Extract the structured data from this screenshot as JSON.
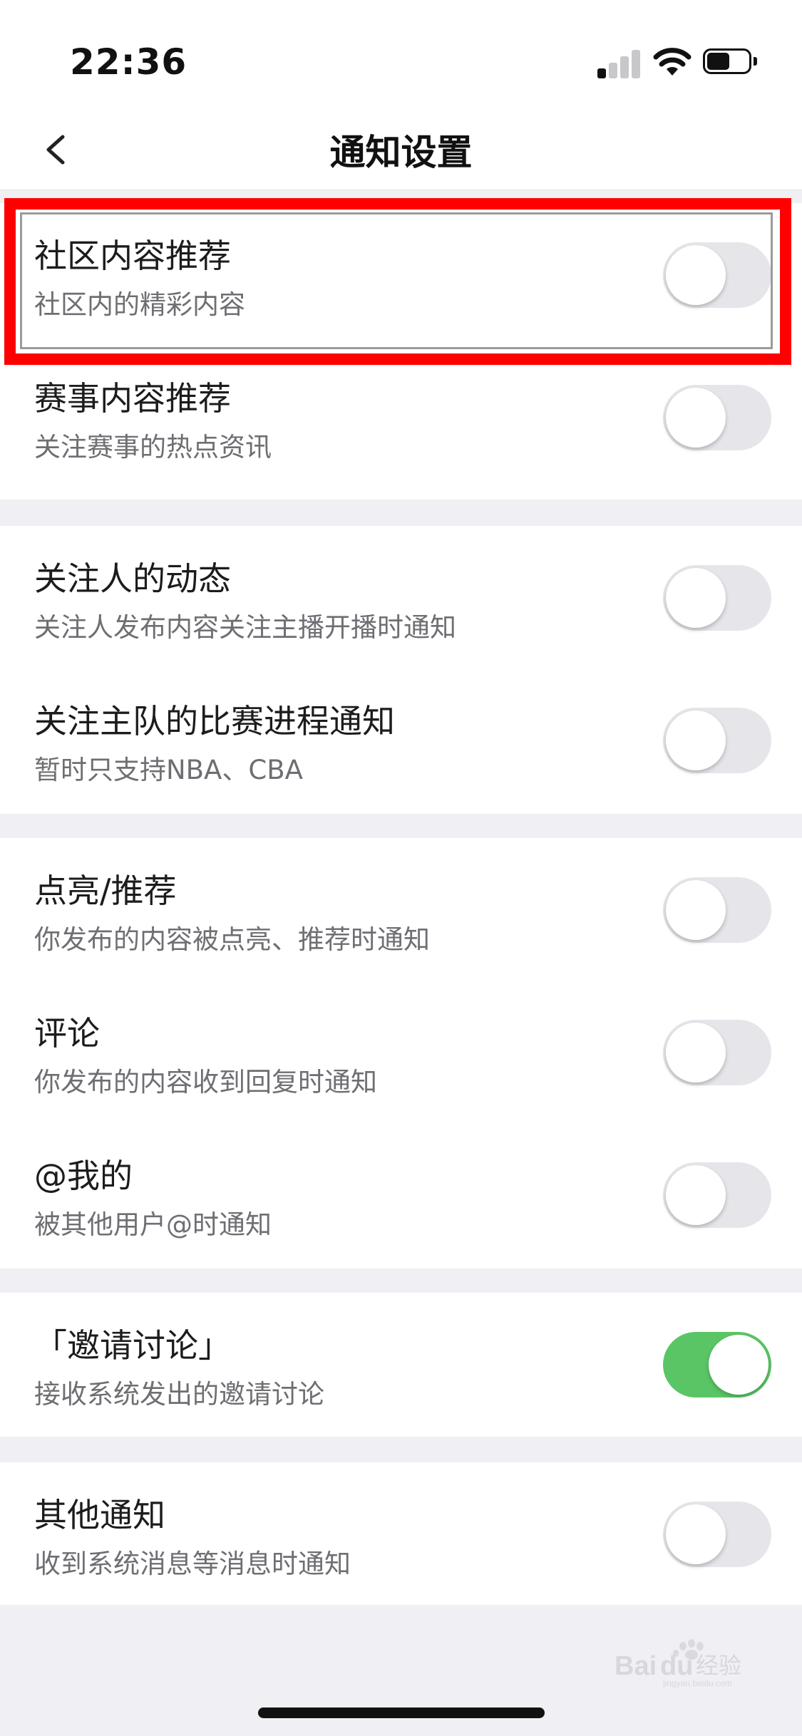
{
  "status_bar": {
    "time": "22:36",
    "battery_level": 0.55
  },
  "nav": {
    "title": "通知设置",
    "back_icon": "chevron-left-icon"
  },
  "settings": [
    {
      "title": "社区内容推荐",
      "subtitle": "社区内的精彩内容",
      "enabled": false
    },
    {
      "title": "赛事内容推荐",
      "subtitle": "关注赛事的热点资讯",
      "enabled": false
    },
    {
      "title": "关注人的动态",
      "subtitle": "关注人发布内容关注主播开播时通知",
      "enabled": false
    },
    {
      "title": "关注主队的比赛进程通知",
      "subtitle": "暂时只支持NBA、CBA",
      "enabled": false
    },
    {
      "title": "点亮/推荐",
      "subtitle": "你发布的内容被点亮、推荐时通知",
      "enabled": false
    },
    {
      "title": "评论",
      "subtitle": "你发布的内容收到回复时通知",
      "enabled": false
    },
    {
      "title": "@我的",
      "subtitle": "被其他用户@时通知",
      "enabled": false
    },
    {
      "title": "「邀请讨论」",
      "subtitle": "接收系统发出的邀请讨论",
      "enabled": true
    },
    {
      "title": "其他通知",
      "subtitle": "收到系统消息等消息时通知",
      "enabled": false
    }
  ],
  "colors": {
    "toggle_on": "#5ac565",
    "toggle_off": "#e5e5ea",
    "highlight": "#ff0000",
    "background": "#efeff4"
  },
  "watermark": {
    "brand": "Baidu",
    "suffix": "经验",
    "site": "jingyan.baidu.com"
  }
}
